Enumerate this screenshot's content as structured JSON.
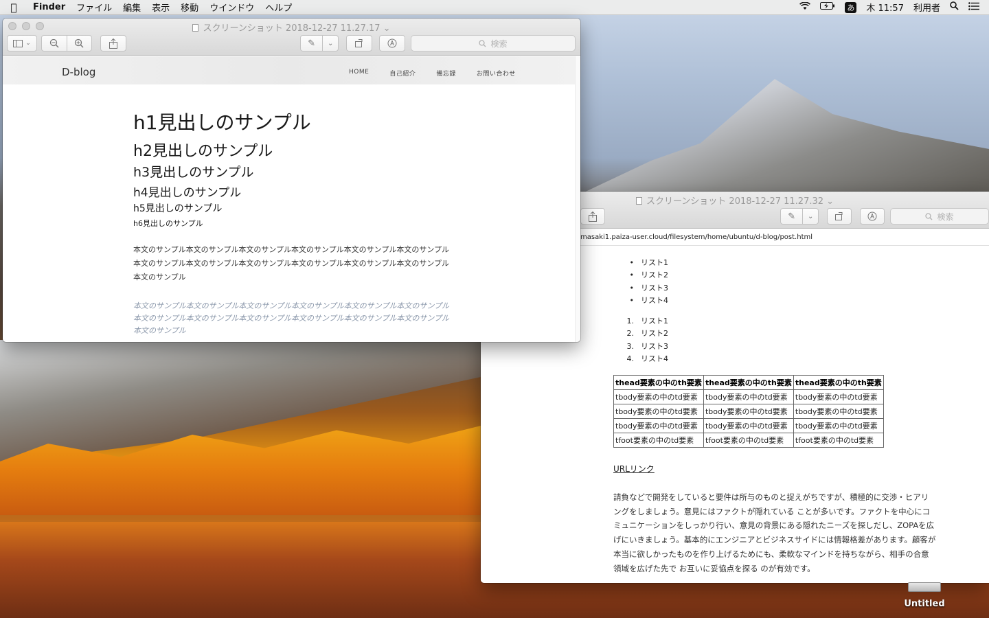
{
  "menubar": {
    "app": "Finder",
    "items": [
      "ファイル",
      "編集",
      "表示",
      "移動",
      "ウインドウ",
      "ヘルプ"
    ],
    "input_mode": "あ",
    "clock": "木 11:57",
    "user": "利用者"
  },
  "window1": {
    "title": "スクリーンショット 2018-12-27 11.27.17",
    "search_placeholder": "検索",
    "blog": {
      "brand": "D-blog",
      "nav": [
        "HOME",
        "自己紹介",
        "備忘録",
        "お問い合わせ"
      ],
      "headings": {
        "h1": "h1見出しのサンプル",
        "h2": "h2見出しのサンプル",
        "h3": "h3見出しのサンプル",
        "h4": "h4見出しのサンプル",
        "h5": "h5見出しのサンプル",
        "h6": "h6見出しのサンプル"
      },
      "paragraph": "本文のサンプル本文のサンプル本文のサンプル本文のサンプル本文のサンプル本文のサンプル本文のサンプル本文のサンプル本文のサンプル本文のサンプル本文のサンプル本文のサンプル本文のサンプル",
      "quote": "本文のサンプル本文のサンプル本文のサンプル本文のサンプル本文のサンプル本文のサンプル本文のサンプル本文のサンプル本文のサンプル本文のサンプル本文のサンプル本文のサンプル本文のサンプル"
    }
  },
  "window2": {
    "title": "スクリーンショット 2018-12-27 11.27.32",
    "search_placeholder": "検索",
    "url": "masaki1.paiza-user.cloud/filesystem/home/ubuntu/d-blog/post.html",
    "ul": [
      "リスト1",
      "リスト2",
      "リスト3",
      "リスト4"
    ],
    "ol": [
      "リスト1",
      "リスト2",
      "リスト3",
      "リスト4"
    ],
    "table": {
      "head": [
        "thead要素の中のth要素",
        "thead要素の中のth要素",
        "thead要素の中のth要素"
      ],
      "body": [
        [
          "tbody要素の中のtd要素",
          "tbody要素の中のtd要素",
          "tbody要素の中のtd要素"
        ],
        [
          "tbody要素の中のtd要素",
          "tbody要素の中のtd要素",
          "tbody要素の中のtd要素"
        ],
        [
          "tbody要素の中のtd要素",
          "tbody要素の中のtd要素",
          "tbody要素の中のtd要素"
        ]
      ],
      "foot": [
        "tfoot要素の中のtd要素",
        "tfoot要素の中のtd要素",
        "tfoot要素の中のtd要素"
      ]
    },
    "link": "URLリンク",
    "body_text": "請負などで開発をしていると要件は所与のものと捉えがちですが、積極的に交渉・ヒアリングをしましょう。意見にはファクトが隠れている ことが多いです。ファクトを中心にコミュニケーションをしっかり行い、意見の背景にある隠れたニーズを探しだし、ZOPAを広げにいきましょう。基本的にエンジニアとビジネスサイドには情報格差があります。顧客が本当に欲しかったものを作り上げるためにも、柔軟なマインドを持ちながら、相手の合意領域を広げた先で お互いに妥協点を探る のが有効です。"
  },
  "desktop": {
    "disk_label": "Untitled"
  }
}
